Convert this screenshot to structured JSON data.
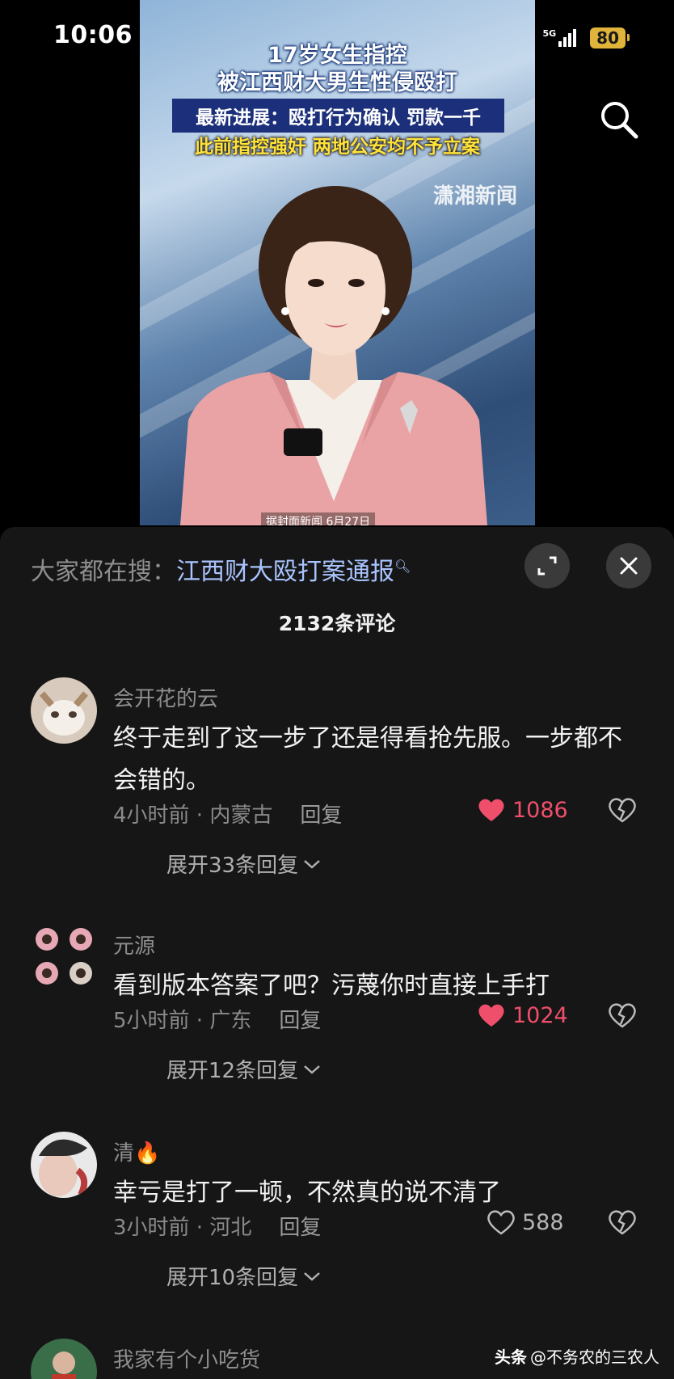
{
  "status_bar": {
    "time": "10:06",
    "network_1": "5G",
    "network_2": "5G",
    "battery": "80"
  },
  "video": {
    "headline_line1": "17岁女生指控",
    "headline_line2": "被江西财大男生性侵殴打",
    "headline_line3": "最新进展：殴打行为确认 罚款一千",
    "headline_line4": "此前指控强奸 两地公安均不予立案",
    "watermark": "潇湘新闻",
    "caption": "据封面新闻 6月27日"
  },
  "sheet": {
    "search_prefix": "大家都在搜：",
    "search_keyword": "江西财大殴打案通报",
    "comment_count": "2132条评论"
  },
  "comments": [
    {
      "username": "会开花的云",
      "text": "终于走到了这一步了还是得看抢先服。一步都不会错的。",
      "time_location": "4小时前 · 内蒙古",
      "reply_label": "回复",
      "likes": "1086",
      "liked": true,
      "expand_label": "展开33条回复"
    },
    {
      "username": "元源",
      "text": "看到版本答案了吧？污蔑你时直接上手打",
      "time_location": "5小时前 · 广东",
      "reply_label": "回复",
      "likes": "1024",
      "liked": true,
      "expand_label": "展开12条回复"
    },
    {
      "username": "清🔥",
      "text": "幸亏是打了一顿，不然真的说不清了",
      "time_location": "3小时前 · 河北",
      "reply_label": "回复",
      "likes": "588",
      "liked": false,
      "expand_label": "展开10条回复"
    },
    {
      "username": "我家有个小吃货"
    }
  ],
  "footer": {
    "brand": "头条",
    "author": "@不务农的三农人"
  },
  "colors": {
    "like_active": "#f04f6b",
    "keyword_link": "#a9c4ff",
    "battery": "#e0b43a"
  }
}
